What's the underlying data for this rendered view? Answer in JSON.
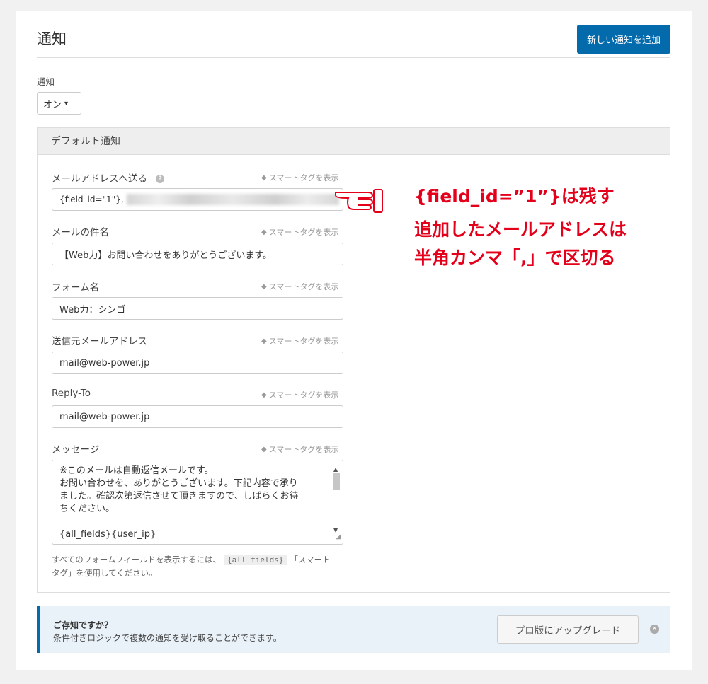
{
  "header": {
    "title": "通知",
    "add_button": "新しい通知を追加"
  },
  "notifications": {
    "label": "通知",
    "select_value": "オン"
  },
  "default_notification": {
    "heading": "デフォルト通知",
    "smart_tag_label": "スマートタグを表示",
    "fields": {
      "send_to": {
        "label": "メールアドレスへ送る",
        "value": "{field_id=\"1\"},"
      },
      "subject": {
        "label": "メールの件名",
        "value": "【Web力】お問い合わせをありがとうございます。"
      },
      "from_name": {
        "label": "フォーム名",
        "value": "Web力：シンゴ"
      },
      "from_email": {
        "label": "送信元メールアドレス",
        "value": "mail@web-power.jp"
      },
      "reply_to": {
        "label": "Reply-To",
        "value": "mail@web-power.jp"
      },
      "message": {
        "label": "メッセージ",
        "lines": [
          "※このメールは自動返信メールです。",
          "お問い合わせを、ありがとうございます。下記内容で承り",
          "ました。確認次第返信させて頂きますので、しばらくお待",
          "ちください。",
          "",
          "{all_fields}{user_ip}"
        ]
      }
    },
    "help_text": {
      "before": "すべてのフォームフィールドを表示するには、",
      "code": "{all_fields}",
      "after_line1": "「スマート",
      "line2": "タグ」を使用してください。"
    }
  },
  "did_you_know": {
    "title": "ご存知ですか？",
    "text": "条件付きロジックで複数の通知を受け取ることができます。",
    "upgrade_button": "プロ版にアップグレード"
  },
  "annotation": {
    "line1": "{field_id=”1”}は残す",
    "line2": "追加したメールアドレスは",
    "line3": "半角カンマ「,」で区切る",
    "color": "#e4001b"
  },
  "colors": {
    "primary": "#036aab",
    "background": "#f1f1f1",
    "annotation_red": "#e4001b"
  },
  "icons": {
    "help": "question-circle-icon",
    "tag": "tag-icon",
    "dismiss": "close-circle-icon",
    "pointing_hand": "pointing-hand-icon"
  }
}
